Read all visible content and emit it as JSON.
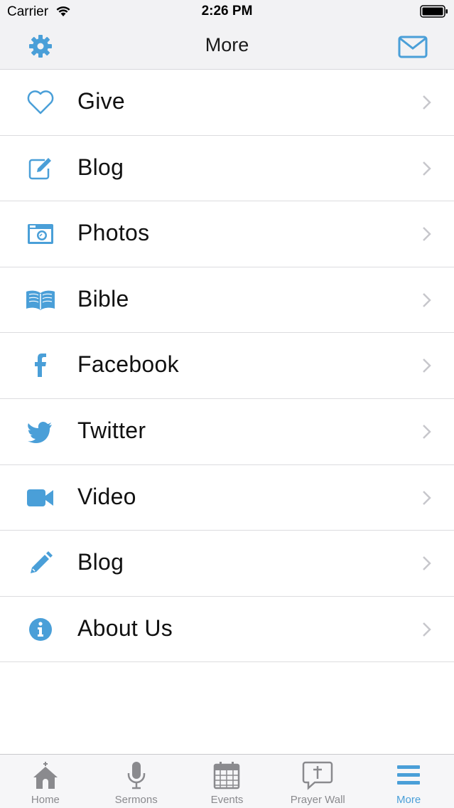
{
  "status_bar": {
    "carrier": "Carrier",
    "time": "2:26 PM"
  },
  "nav": {
    "title": "More",
    "left_icon": "gear-icon",
    "right_icon": "mail-icon"
  },
  "colors": {
    "accent": "#4a9fd8",
    "tab_inactive": "#8a8a8e",
    "chevron": "#c7c7cc"
  },
  "menu": {
    "items": [
      {
        "label": "Give",
        "icon": "heart-icon"
      },
      {
        "label": "Blog",
        "icon": "edit-icon"
      },
      {
        "label": "Photos",
        "icon": "camera-icon"
      },
      {
        "label": "Bible",
        "icon": "book-icon"
      },
      {
        "label": "Facebook",
        "icon": "facebook-icon"
      },
      {
        "label": "Twitter",
        "icon": "twitter-icon"
      },
      {
        "label": "Video",
        "icon": "video-camera-icon"
      },
      {
        "label": "Blog",
        "icon": "pencil-icon"
      },
      {
        "label": "About Us",
        "icon": "info-icon"
      }
    ]
  },
  "tabs": [
    {
      "label": "Home",
      "icon": "church-icon",
      "active": false
    },
    {
      "label": "Sermons",
      "icon": "microphone-icon",
      "active": false
    },
    {
      "label": "Events",
      "icon": "calendar-icon",
      "active": false
    },
    {
      "label": "Prayer Wall",
      "icon": "prayer-bubble-icon",
      "active": false
    },
    {
      "label": "More",
      "icon": "menu-icon",
      "active": true
    }
  ]
}
